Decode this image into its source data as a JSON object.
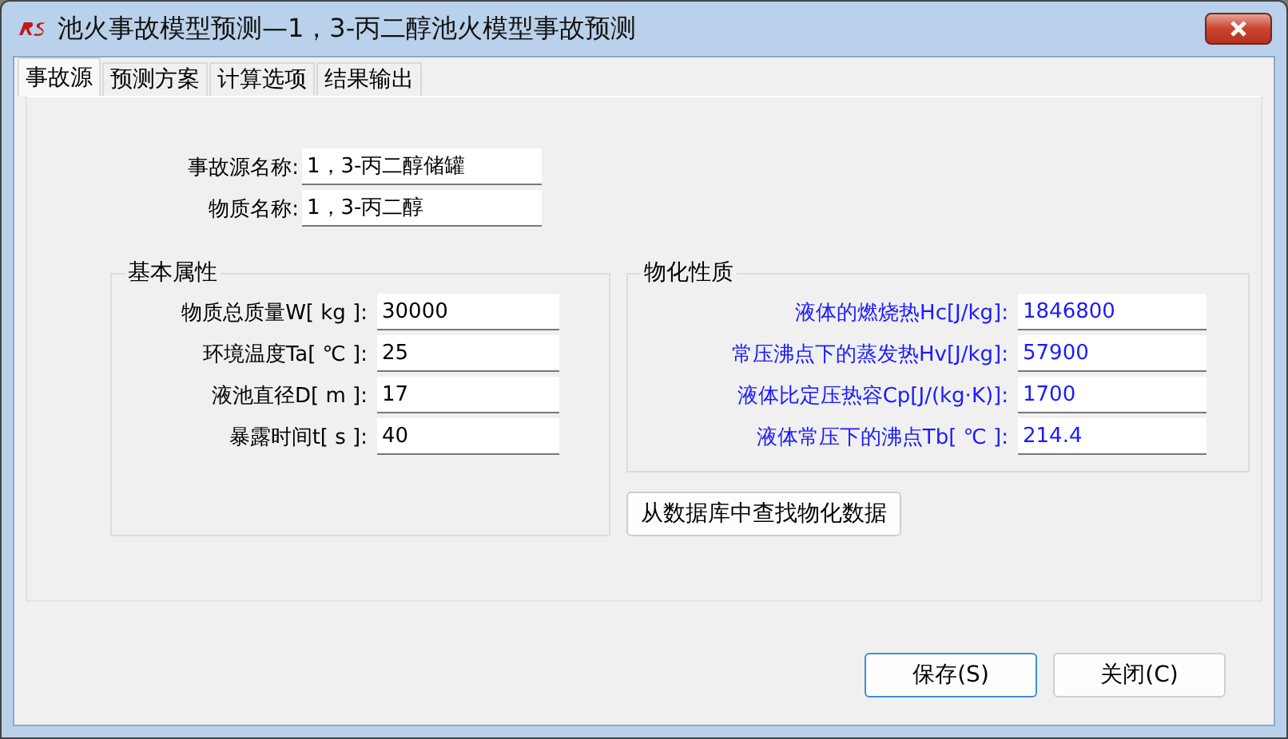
{
  "window": {
    "title": "池火事故模型预测—1，3-丙二醇池火模型事故预测"
  },
  "tabs": [
    {
      "label": "事故源",
      "selected": true
    },
    {
      "label": "预测方案",
      "selected": false
    },
    {
      "label": "计算选项",
      "selected": false
    },
    {
      "label": "结果输出",
      "selected": false
    }
  ],
  "source_fields": [
    {
      "label": "事故源名称:",
      "value": "1，3-丙二醇储罐"
    },
    {
      "label": "物质名称:",
      "value": "1，3-丙二醇"
    }
  ],
  "basic_properties": {
    "title": "基本属性",
    "fields": [
      {
        "label": "物质总质量W[ kg ]:",
        "value": "30000"
      },
      {
        "label": "环境温度Ta[ ℃ ]:",
        "value": "25"
      },
      {
        "label": "液池直径D[  m ]:",
        "value": "17"
      },
      {
        "label": "暴露时间t[ s ]:",
        "value": "40"
      }
    ]
  },
  "physical_properties": {
    "title": "物化性质",
    "fields": [
      {
        "label": "液体的燃烧热Hc[J/kg]:",
        "value": "1846800"
      },
      {
        "label": "常压沸点下的蒸发热Hv[J/kg]:",
        "value": "57900"
      },
      {
        "label": "液体比定压热容Cp[J/(kg·K)]:",
        "value": "1700"
      },
      {
        "label": "液体常压下的沸点Tb[ ℃ ]:",
        "value": "214.4"
      }
    ]
  },
  "lookup_button": "从数据库中查找物化数据",
  "buttons": [
    {
      "label": "保存(S)",
      "selected": true
    },
    {
      "label": "关闭(C)",
      "selected": false
    }
  ]
}
